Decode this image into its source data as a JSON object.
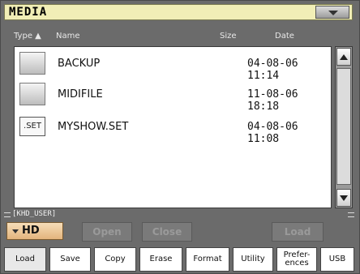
{
  "window": {
    "title": "MEDIA"
  },
  "columns": {
    "type": "Type ▲",
    "name": "Name",
    "size": "Size",
    "date": "Date"
  },
  "files": [
    {
      "icon": "folder-icon",
      "icon_text": "",
      "name": "BACKUP",
      "date": "04-08-06 11:14"
    },
    {
      "icon": "folder-icon",
      "icon_text": "",
      "name": "MIDIFILE",
      "date": "11-08-06 18:18"
    },
    {
      "icon": "set-file-icon",
      "icon_text": ".SET",
      "name": "MYSHOW.SET",
      "date": "04-08-06 11:08"
    }
  ],
  "path": "[KHD_USER]",
  "device": {
    "label": "HD"
  },
  "actions": {
    "open": "Open",
    "close": "Close",
    "load": "Load"
  },
  "tabs": [
    {
      "label": "Load",
      "active": true
    },
    {
      "label": "Save",
      "active": false
    },
    {
      "label": "Copy",
      "active": false
    },
    {
      "label": "Erase",
      "active": false
    },
    {
      "label": "Format",
      "active": false
    },
    {
      "label": "Utility",
      "active": false
    },
    {
      "label": "Prefer-\nences",
      "active": false
    },
    {
      "label": "USB",
      "active": false
    }
  ],
  "colors": {
    "title_bar": "#f1eeb6",
    "panel_bg": "#6b6b6b",
    "device_button": "#e9c08a",
    "disabled_button": "#7a7a7a"
  }
}
